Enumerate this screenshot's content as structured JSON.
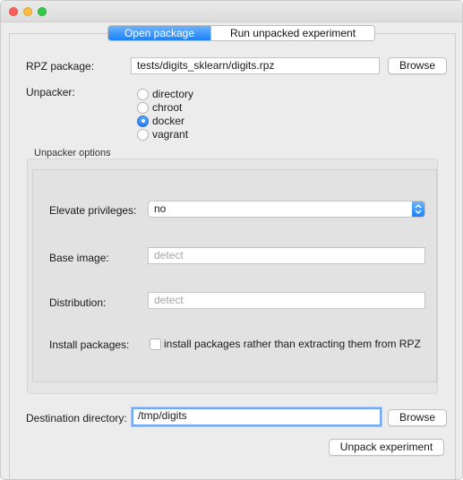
{
  "window": {
    "close_icon": "close-icon",
    "minimize_icon": "minimize-icon",
    "maximize_icon": "maximize-icon"
  },
  "tabs": [
    {
      "label": "Open package",
      "active": true
    },
    {
      "label": "Run unpacked experiment",
      "active": false
    }
  ],
  "rpz": {
    "label": "RPZ package:",
    "value": "tests/digits_sklearn/digits.rpz",
    "browse_label": "Browse"
  },
  "unpacker": {
    "label": "Unpacker:",
    "options": [
      "directory",
      "chroot",
      "docker",
      "vagrant"
    ],
    "selected": "docker"
  },
  "options_group": {
    "title": "Unpacker options",
    "elevate": {
      "label": "Elevate privileges:",
      "value": "no"
    },
    "base_image": {
      "label": "Base image:",
      "placeholder": "detect"
    },
    "distribution": {
      "label": "Distribution:",
      "placeholder": "detect"
    },
    "install": {
      "label": "Install packages:",
      "checkbox_label": "install packages rather than extracting them from RPZ",
      "checked": false
    }
  },
  "destination": {
    "label": "Destination directory:",
    "value": "/tmp/digits",
    "browse_label": "Browse"
  },
  "unpack_button": "Unpack experiment",
  "colors": {
    "accent": "#1a82fb",
    "close": "#fc605c",
    "minimize": "#fdbc40",
    "maximize": "#34c84a"
  }
}
